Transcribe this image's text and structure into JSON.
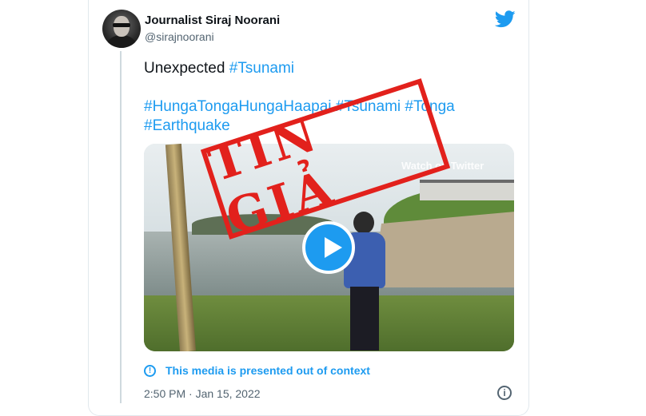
{
  "author": {
    "name": "Journalist Siraj Noorani",
    "handle": "@sirajnoorani"
  },
  "tweet": {
    "line1_text": "Unexpected ",
    "line1_tag": "#Tsunami",
    "tags_line": "#HungaTongaHungaHaapai #Tsunami #Tonga",
    "tags_line2": "#Earthquake"
  },
  "media": {
    "watermark": "Watch on Twitter",
    "stamp_text": "TIN GIẢ"
  },
  "notice": "This media is presented out of context",
  "timestamp": "2:50 PM · Jan 15, 2022",
  "colors": {
    "accent": "#1d9bf0",
    "stamp": "#e2211c"
  },
  "icons": [
    "twitter-bird-icon",
    "play-icon",
    "info-circle-icon",
    "info-icon"
  ]
}
